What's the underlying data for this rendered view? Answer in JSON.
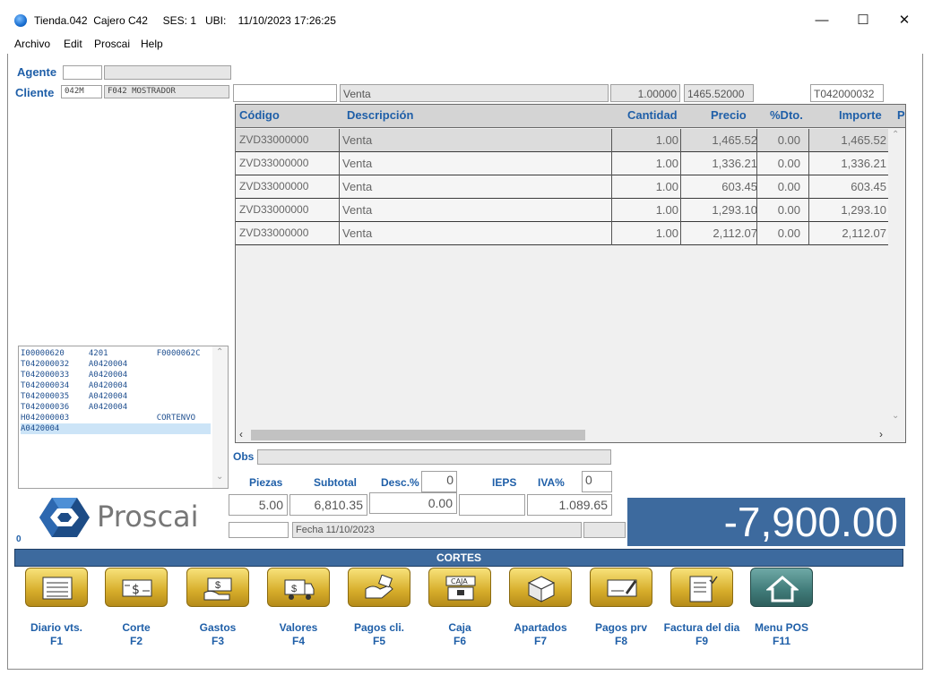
{
  "window": {
    "title": "Tienda.042  Cajero C42     SES: 1   UBI:    11/10/2023 17:26:25",
    "minimize": "—",
    "maximize": "☐",
    "close": "✕"
  },
  "menu": [
    "Archivo",
    "Edit",
    "Proscai",
    "Help"
  ],
  "agente": {
    "label": "Agente",
    "code": "",
    "name": ""
  },
  "cliente": {
    "label": "Cliente",
    "code": "042M",
    "name": "F042 MOSTRADOR"
  },
  "entry": {
    "code": "",
    "description": "Venta",
    "quantity": "1.00000",
    "price": "1465.52000",
    "ticket": "T042000032"
  },
  "table": {
    "columns": [
      "Código",
      "Descripción",
      "Cantidad",
      "Precio",
      "%Dto.",
      "Importe",
      "P"
    ],
    "rows": [
      {
        "codigo": "ZVD33000000",
        "descripcion": "Venta",
        "cantidad": "1.00",
        "precio": "1,465.52",
        "dto": "0.00",
        "importe": "1,465.52"
      },
      {
        "codigo": "ZVD33000000",
        "descripcion": "Venta",
        "cantidad": "1.00",
        "precio": "1,336.21",
        "dto": "0.00",
        "importe": "1,336.21"
      },
      {
        "codigo": "ZVD33000000",
        "descripcion": "Venta",
        "cantidad": "1.00",
        "precio": "603.45",
        "dto": "0.00",
        "importe": "603.45"
      },
      {
        "codigo": "ZVD33000000",
        "descripcion": "Venta",
        "cantidad": "1.00",
        "precio": "1,293.10",
        "dto": "0.00",
        "importe": "1,293.10"
      },
      {
        "codigo": "ZVD33000000",
        "descripcion": "Venta",
        "cantidad": "1.00",
        "precio": "2,112.07",
        "dto": "0.00",
        "importe": "2,112.07"
      }
    ]
  },
  "list": [
    "I00000620     4201          F0000062C",
    "T042000032    A0420004",
    "T042000033    A0420004",
    "T042000034    A0420004",
    "T042000035    A0420004",
    "T042000036    A0420004",
    "H042000003                  CORTENVO",
    "A0420004"
  ],
  "obs": {
    "label": "Obs",
    "value": ""
  },
  "totals": {
    "piezas_label": "Piezas",
    "piezas": "5.00",
    "subtotal_label": "Subtotal",
    "subtotal": "6,810.35",
    "desc_label": "Desc.%",
    "desc_pct": "0",
    "desc": "0.00",
    "ieps_label": "IEPS",
    "ieps": "",
    "iva_label": "IVA%",
    "iva_pct": "0",
    "iva": "1.089.65",
    "fecha": "Fecha 11/10/2023",
    "total": "-7,900.00"
  },
  "brand": {
    "name": "Proscai",
    "counter": "0"
  },
  "cortes_label": "CORTES",
  "function_buttons": [
    {
      "label": "Diario vts.",
      "key": "F1",
      "icon": "ledger-icon"
    },
    {
      "label": "Corte",
      "key": "F2",
      "icon": "cash-icon"
    },
    {
      "label": "Gastos",
      "key": "F3",
      "icon": "money-hand-icon"
    },
    {
      "label": "Valores",
      "key": "F4",
      "icon": "armored-truck-icon"
    },
    {
      "label": "Pagos cli.",
      "key": "F5",
      "icon": "payment-hand-icon"
    },
    {
      "label": "Caja",
      "key": "F6",
      "icon": "cash-register-icon",
      "icon_text": "CAJA"
    },
    {
      "label": "Apartados",
      "key": "F7",
      "icon": "package-icon"
    },
    {
      "label": "Pagos prv",
      "key": "F8",
      "icon": "check-sign-icon"
    },
    {
      "label": "Factura del dia",
      "key": "F9",
      "icon": "invoice-icon"
    },
    {
      "label": "Menu POS",
      "key": "F11",
      "icon": "home-icon"
    }
  ]
}
